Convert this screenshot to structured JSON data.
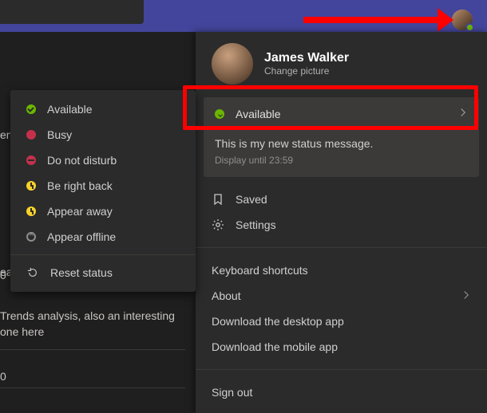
{
  "titlebar": {},
  "user": {
    "name": "James Walker",
    "change_picture": "Change picture"
  },
  "status": {
    "current_label": "Available",
    "message": "This is my new status message.",
    "display_until": "Display until 23:59"
  },
  "panel_menu": {
    "saved": "Saved",
    "settings": "Settings",
    "shortcuts": "Keyboard shortcuts",
    "about": "About",
    "download_desktop": "Download the desktop app",
    "download_mobile": "Download the mobile app",
    "sign_out": "Sign out"
  },
  "status_options": {
    "available": "Available",
    "busy": "Busy",
    "dnd": "Do not disturb",
    "brb": "Be right back",
    "away": "Appear away",
    "offline": "Appear offline",
    "reset": "Reset status"
  },
  "background": {
    "line1": "en",
    "line2": "ea",
    "trends": "Trends analysis, also an interesting one here",
    "zero_a": "0",
    "zero_b": "0"
  },
  "colors": {
    "accent": "#43459c",
    "panel": "#2b2b2b",
    "highlight": "#ff0000",
    "available": "#6bb700",
    "busy": "#c4314b",
    "away": "#f8d22a"
  }
}
